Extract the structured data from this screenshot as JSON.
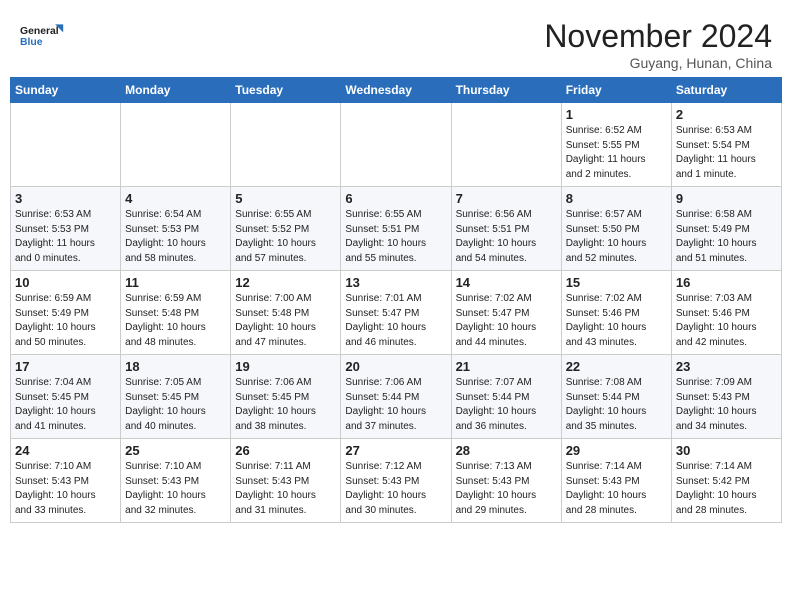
{
  "header": {
    "logo_line1": "General",
    "logo_line2": "Blue",
    "month": "November 2024",
    "location": "Guyang, Hunan, China"
  },
  "weekdays": [
    "Sunday",
    "Monday",
    "Tuesday",
    "Wednesday",
    "Thursday",
    "Friday",
    "Saturday"
  ],
  "weeks": [
    [
      {
        "day": "",
        "info": ""
      },
      {
        "day": "",
        "info": ""
      },
      {
        "day": "",
        "info": ""
      },
      {
        "day": "",
        "info": ""
      },
      {
        "day": "",
        "info": ""
      },
      {
        "day": "1",
        "info": "Sunrise: 6:52 AM\nSunset: 5:55 PM\nDaylight: 11 hours\nand 2 minutes."
      },
      {
        "day": "2",
        "info": "Sunrise: 6:53 AM\nSunset: 5:54 PM\nDaylight: 11 hours\nand 1 minute."
      }
    ],
    [
      {
        "day": "3",
        "info": "Sunrise: 6:53 AM\nSunset: 5:53 PM\nDaylight: 11 hours\nand 0 minutes."
      },
      {
        "day": "4",
        "info": "Sunrise: 6:54 AM\nSunset: 5:53 PM\nDaylight: 10 hours\nand 58 minutes."
      },
      {
        "day": "5",
        "info": "Sunrise: 6:55 AM\nSunset: 5:52 PM\nDaylight: 10 hours\nand 57 minutes."
      },
      {
        "day": "6",
        "info": "Sunrise: 6:55 AM\nSunset: 5:51 PM\nDaylight: 10 hours\nand 55 minutes."
      },
      {
        "day": "7",
        "info": "Sunrise: 6:56 AM\nSunset: 5:51 PM\nDaylight: 10 hours\nand 54 minutes."
      },
      {
        "day": "8",
        "info": "Sunrise: 6:57 AM\nSunset: 5:50 PM\nDaylight: 10 hours\nand 52 minutes."
      },
      {
        "day": "9",
        "info": "Sunrise: 6:58 AM\nSunset: 5:49 PM\nDaylight: 10 hours\nand 51 minutes."
      }
    ],
    [
      {
        "day": "10",
        "info": "Sunrise: 6:59 AM\nSunset: 5:49 PM\nDaylight: 10 hours\nand 50 minutes."
      },
      {
        "day": "11",
        "info": "Sunrise: 6:59 AM\nSunset: 5:48 PM\nDaylight: 10 hours\nand 48 minutes."
      },
      {
        "day": "12",
        "info": "Sunrise: 7:00 AM\nSunset: 5:48 PM\nDaylight: 10 hours\nand 47 minutes."
      },
      {
        "day": "13",
        "info": "Sunrise: 7:01 AM\nSunset: 5:47 PM\nDaylight: 10 hours\nand 46 minutes."
      },
      {
        "day": "14",
        "info": "Sunrise: 7:02 AM\nSunset: 5:47 PM\nDaylight: 10 hours\nand 44 minutes."
      },
      {
        "day": "15",
        "info": "Sunrise: 7:02 AM\nSunset: 5:46 PM\nDaylight: 10 hours\nand 43 minutes."
      },
      {
        "day": "16",
        "info": "Sunrise: 7:03 AM\nSunset: 5:46 PM\nDaylight: 10 hours\nand 42 minutes."
      }
    ],
    [
      {
        "day": "17",
        "info": "Sunrise: 7:04 AM\nSunset: 5:45 PM\nDaylight: 10 hours\nand 41 minutes."
      },
      {
        "day": "18",
        "info": "Sunrise: 7:05 AM\nSunset: 5:45 PM\nDaylight: 10 hours\nand 40 minutes."
      },
      {
        "day": "19",
        "info": "Sunrise: 7:06 AM\nSunset: 5:45 PM\nDaylight: 10 hours\nand 38 minutes."
      },
      {
        "day": "20",
        "info": "Sunrise: 7:06 AM\nSunset: 5:44 PM\nDaylight: 10 hours\nand 37 minutes."
      },
      {
        "day": "21",
        "info": "Sunrise: 7:07 AM\nSunset: 5:44 PM\nDaylight: 10 hours\nand 36 minutes."
      },
      {
        "day": "22",
        "info": "Sunrise: 7:08 AM\nSunset: 5:44 PM\nDaylight: 10 hours\nand 35 minutes."
      },
      {
        "day": "23",
        "info": "Sunrise: 7:09 AM\nSunset: 5:43 PM\nDaylight: 10 hours\nand 34 minutes."
      }
    ],
    [
      {
        "day": "24",
        "info": "Sunrise: 7:10 AM\nSunset: 5:43 PM\nDaylight: 10 hours\nand 33 minutes."
      },
      {
        "day": "25",
        "info": "Sunrise: 7:10 AM\nSunset: 5:43 PM\nDaylight: 10 hours\nand 32 minutes."
      },
      {
        "day": "26",
        "info": "Sunrise: 7:11 AM\nSunset: 5:43 PM\nDaylight: 10 hours\nand 31 minutes."
      },
      {
        "day": "27",
        "info": "Sunrise: 7:12 AM\nSunset: 5:43 PM\nDaylight: 10 hours\nand 30 minutes."
      },
      {
        "day": "28",
        "info": "Sunrise: 7:13 AM\nSunset: 5:43 PM\nDaylight: 10 hours\nand 29 minutes."
      },
      {
        "day": "29",
        "info": "Sunrise: 7:14 AM\nSunset: 5:43 PM\nDaylight: 10 hours\nand 28 minutes."
      },
      {
        "day": "30",
        "info": "Sunrise: 7:14 AM\nSunset: 5:42 PM\nDaylight: 10 hours\nand 28 minutes."
      }
    ]
  ]
}
